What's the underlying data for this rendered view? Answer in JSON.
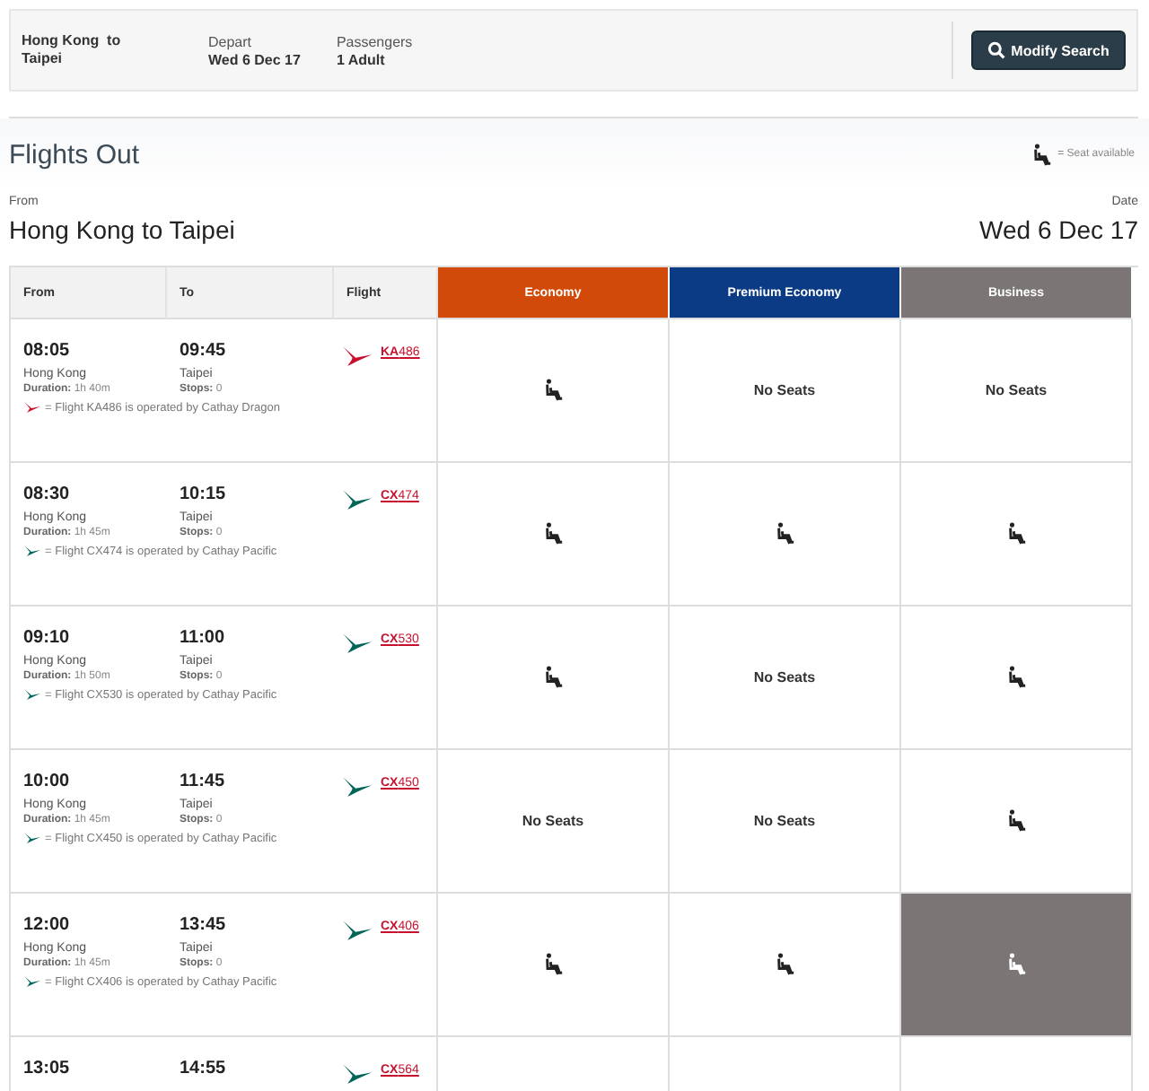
{
  "summary": {
    "route": "Hong Kong  to Taipei",
    "depart_label": "Depart",
    "depart": "Wed 6 Dec 17",
    "passengers_label": "Passengers",
    "passengers": "1 Adult",
    "button": "Modify Search"
  },
  "section": {
    "title": "Flights Out",
    "legend": "= Seat available",
    "from_label": "From",
    "route": "Hong Kong to Taipei",
    "date_label": "Date",
    "date": "Wed 6 Dec 17"
  },
  "columns": [
    "From",
    "To",
    "Flight"
  ],
  "cabins": [
    {
      "label": "Economy",
      "color": "#d24a0a"
    },
    {
      "label": "Premium Economy",
      "color": "#0b3b85"
    },
    {
      "label": "Business",
      "color": "#7b7575"
    }
  ],
  "flights": [
    {
      "dep": "08:05",
      "arr": "09:45",
      "origin": "Hong Kong",
      "dest": "Taipei",
      "duration_label": "Duration:",
      "duration": "1h 40m",
      "stops_label": "Stops:",
      "stops": "0",
      "code": "**KA**486",
      "color": "#c8102e",
      "note": "= Flight KA486 is operated by Cathay Dragon",
      "cells": [
        {
          "kind": "seat",
          "selected": false
        },
        {
          "kind": "none",
          "text": "No Seats"
        },
        {
          "kind": "none",
          "text": "No Seats"
        }
      ]
    },
    {
      "dep": "08:30",
      "arr": "10:15",
      "origin": "Hong Kong",
      "dest": "Taipei",
      "duration_label": "Duration:",
      "duration": "1h 45m",
      "stops_label": "Stops:",
      "stops": "0",
      "code": "**CX**474",
      "color": "#00645a",
      "note": "= Flight CX474 is operated by Cathay Pacific",
      "cells": [
        {
          "kind": "seat",
          "selected": false
        },
        {
          "kind": "seat",
          "selected": false
        },
        {
          "kind": "seat",
          "selected": false
        }
      ]
    },
    {
      "dep": "09:10",
      "arr": "11:00",
      "origin": "Hong Kong",
      "dest": "Taipei",
      "duration_label": "Duration:",
      "duration": "1h 50m",
      "stops_label": "Stops:",
      "stops": "0",
      "code": "**CX**530",
      "color": "#00645a",
      "note": "= Flight CX530 is operated by Cathay Pacific",
      "cells": [
        {
          "kind": "seat",
          "selected": false
        },
        {
          "kind": "none",
          "text": "No Seats"
        },
        {
          "kind": "seat",
          "selected": false
        }
      ]
    },
    {
      "dep": "10:00",
      "arr": "11:45",
      "origin": "Hong Kong",
      "dest": "Taipei",
      "duration_label": "Duration:",
      "duration": "1h 45m",
      "stops_label": "Stops:",
      "stops": "0",
      "code": "**CX**450",
      "color": "#00645a",
      "note": "= Flight CX450 is operated by Cathay Pacific",
      "cells": [
        {
          "kind": "none",
          "text": "No Seats"
        },
        {
          "kind": "none",
          "text": "No Seats"
        },
        {
          "kind": "seat",
          "selected": false
        }
      ]
    },
    {
      "dep": "12:00",
      "arr": "13:45",
      "origin": "Hong Kong",
      "dest": "Taipei",
      "duration_label": "Duration:",
      "duration": "1h 45m",
      "stops_label": "Stops:",
      "stops": "0",
      "code": "**CX**406",
      "color": "#00645a",
      "note": "= Flight CX406 is operated by Cathay Pacific",
      "cells": [
        {
          "kind": "seat",
          "selected": false
        },
        {
          "kind": "seat",
          "selected": false
        },
        {
          "kind": "seat",
          "selected": true
        }
      ]
    },
    {
      "dep": "13:05",
      "arr": "14:55",
      "code": "**CX**564",
      "color": "#00645a"
    }
  ]
}
